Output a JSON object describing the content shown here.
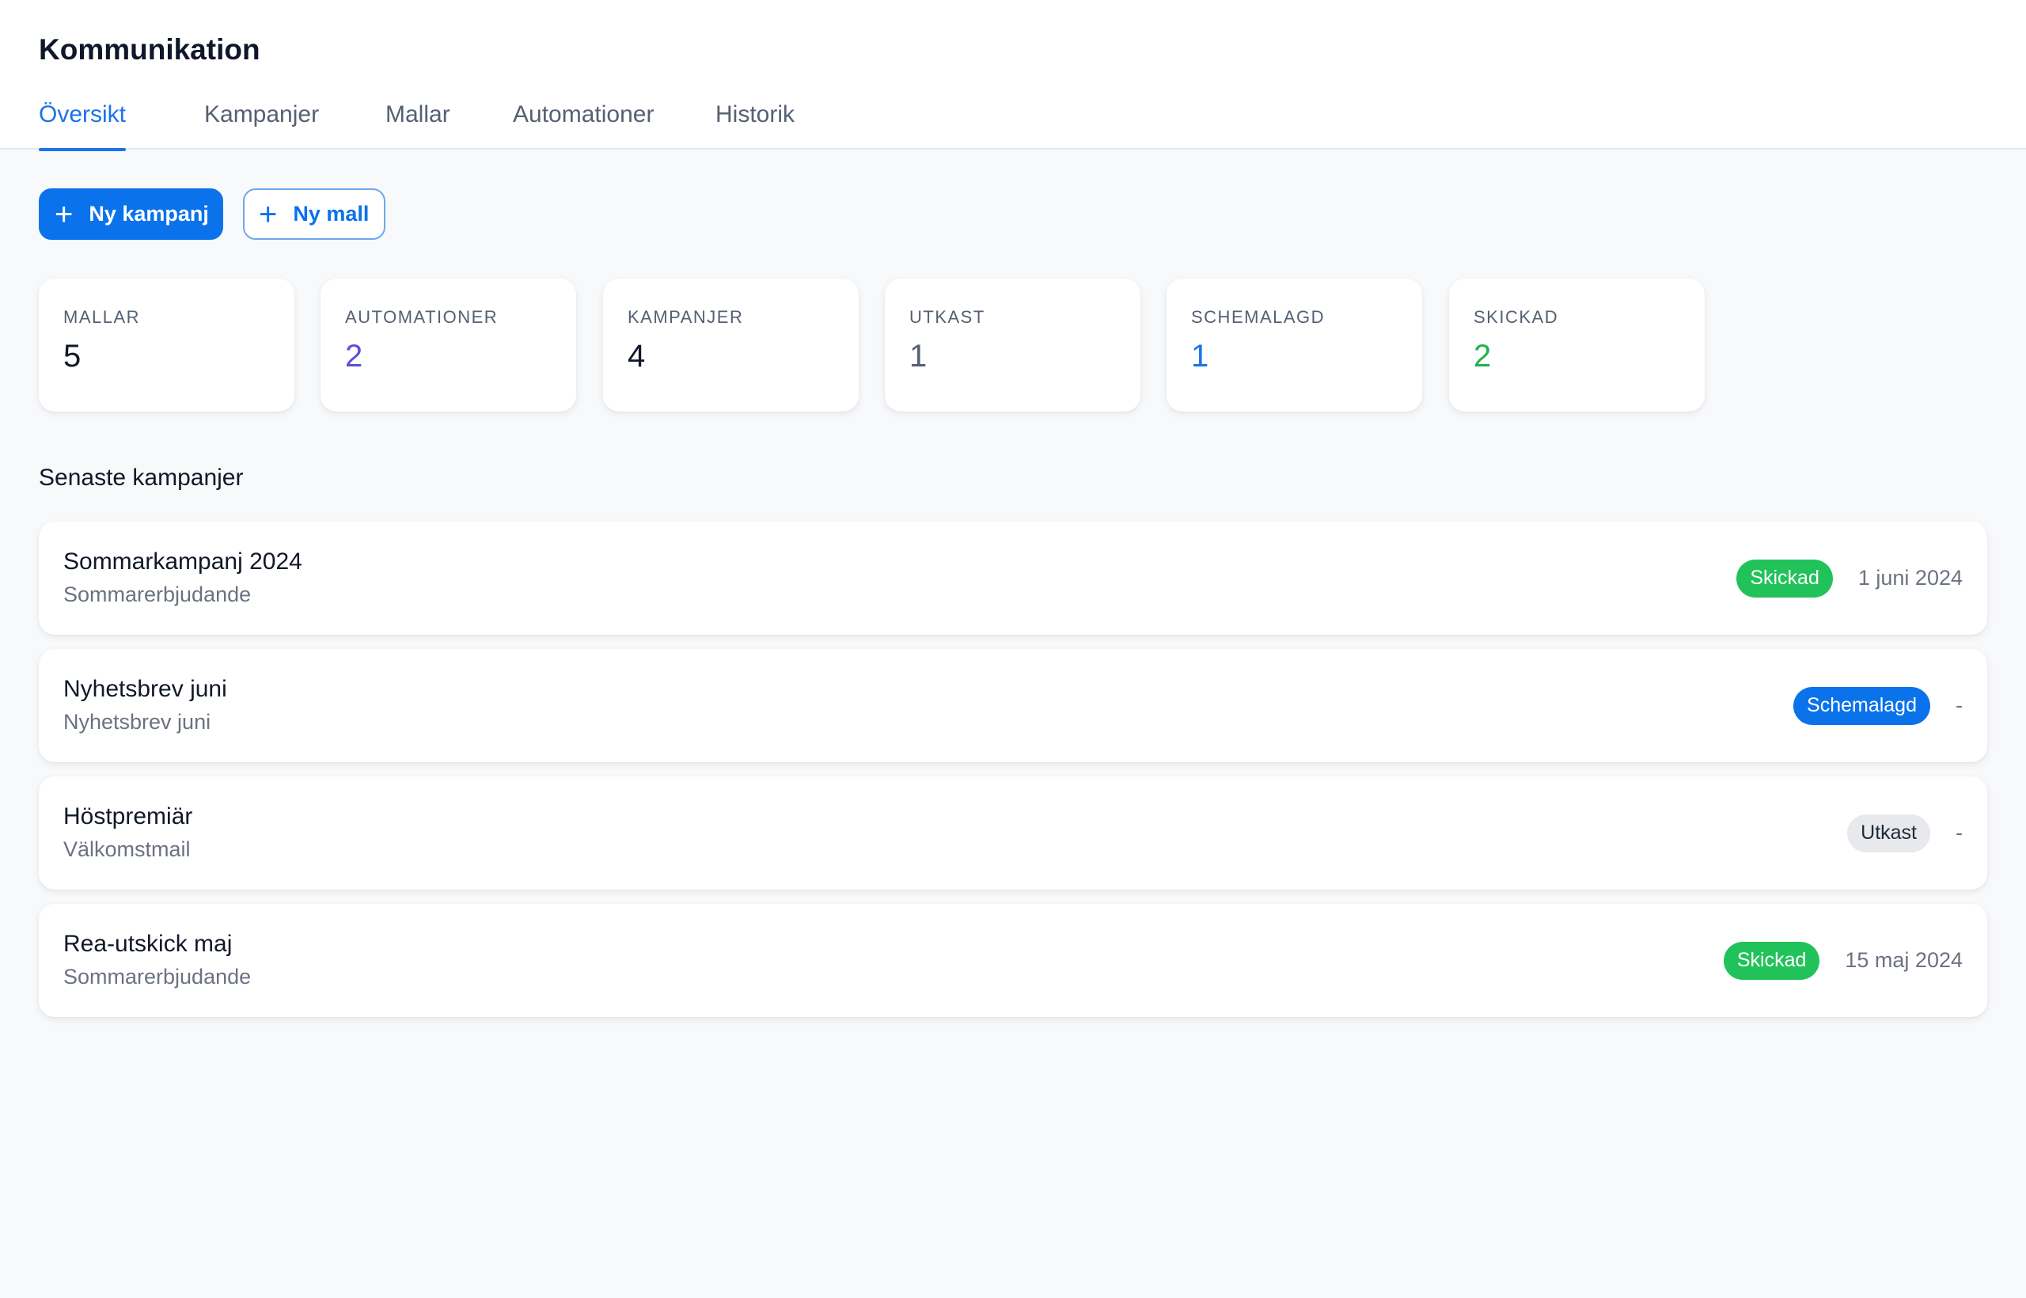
{
  "app": {
    "title": "Kommunikation"
  },
  "tabs": [
    {
      "label": "Översikt",
      "active": true
    },
    {
      "label": "Kampanjer"
    },
    {
      "label": "Mallar"
    },
    {
      "label": "Automationer"
    },
    {
      "label": "Historik"
    }
  ],
  "actions": {
    "new_campaign": "Ny kampanj",
    "new_template": "Ny mall",
    "plus_icon": "+"
  },
  "stats": [
    {
      "label": "MALLAR",
      "value": "5",
      "color": "#111827"
    },
    {
      "label": "AUTOMATIONER",
      "value": "2",
      "color": "#5b4fd6"
    },
    {
      "label": "KAMPANJER",
      "value": "4",
      "color": "#111827"
    },
    {
      "label": "UTKAST",
      "value": "1",
      "color": "#556072"
    },
    {
      "label": "SCHEMALAGD",
      "value": "1",
      "color": "#1a73e8"
    },
    {
      "label": "SKICKAD",
      "value": "2",
      "color": "#22b04f"
    }
  ],
  "recent": {
    "title": "Senaste kampanjer",
    "items": [
      {
        "name": "Sommarkampanj 2024",
        "template": "Sommarerbjudande",
        "status": "Skickad",
        "status_type": "sent",
        "date": "1 juni 2024"
      },
      {
        "name": "Nyhetsbrev juni",
        "template": "Nyhetsbrev juni",
        "status": "Schemalagd",
        "status_type": "scheduled",
        "date": "-"
      },
      {
        "name": "Höstpremiär",
        "template": "Välkomstmail",
        "status": "Utkast",
        "status_type": "draft",
        "date": "-"
      },
      {
        "name": "Rea-utskick maj",
        "template": "Sommarerbjudande",
        "status": "Skickad",
        "status_type": "sent",
        "date": "15 maj 2024"
      }
    ]
  },
  "colors": {
    "accent": "#0a72ea",
    "success": "#22c25a",
    "draft": "#e8e9ec"
  }
}
